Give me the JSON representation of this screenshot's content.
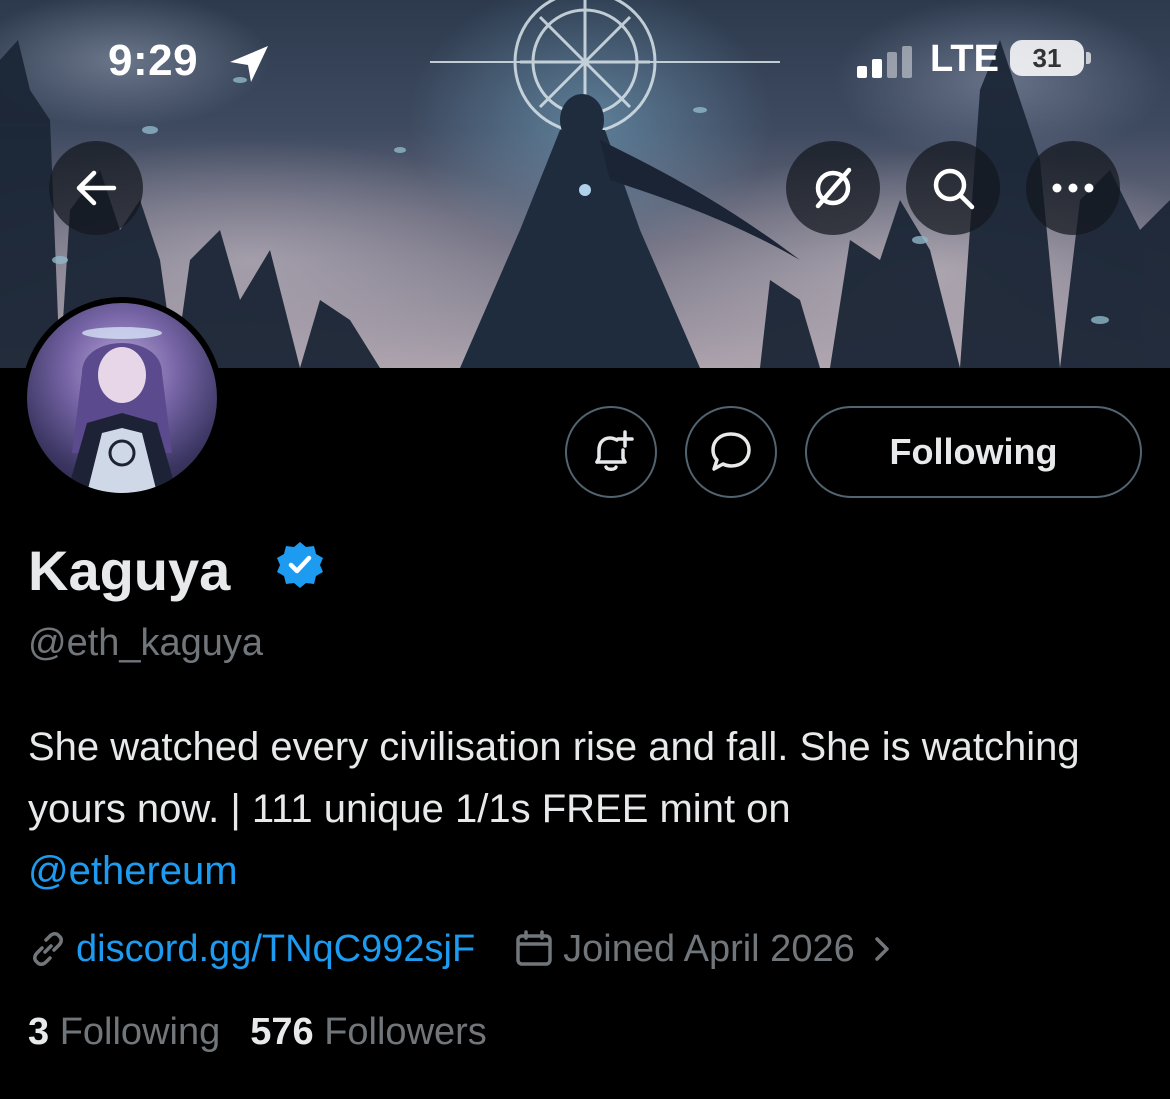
{
  "status_bar": {
    "time": "9:29",
    "network": "LTE",
    "battery": "31"
  },
  "header": {
    "back_icon": "arrow-left-icon",
    "grok_icon": "grok-icon",
    "search_icon": "search-icon",
    "more_icon": "more-horizontal-icon"
  },
  "actions": {
    "notify_icon": "bell-plus-icon",
    "message_icon": "message-bubble-icon",
    "following_label": "Following"
  },
  "profile": {
    "display_name": "Kaguya",
    "verified": true,
    "handle": "@eth_kaguya",
    "bio_text": "She watched every civilisation rise and fall. She is watching yours now. | 111 unique 1/1s FREE mint on",
    "bio_mention": "@ethereum",
    "link": "discord.gg/TNqC992sjF",
    "joined": "Joined April 2026",
    "following_count": "3",
    "following_label": "Following",
    "followers_count": "576",
    "followers_label": "Followers"
  },
  "colors": {
    "accent": "#1d9bf0",
    "muted": "#71767b",
    "text": "#e7e9ea",
    "border": "#536471",
    "background": "#000000"
  }
}
